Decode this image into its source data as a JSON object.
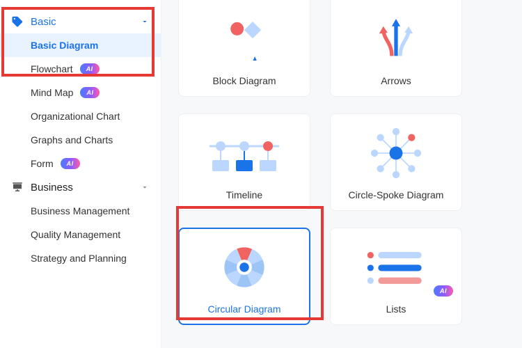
{
  "sidebar": {
    "groups": [
      {
        "id": "basic",
        "label": "Basic",
        "expanded": true,
        "items": [
          {
            "label": "Basic Diagram",
            "selected": true
          },
          {
            "label": "Flowchart",
            "ai": true
          },
          {
            "label": "Mind Map",
            "ai": true
          },
          {
            "label": "Organizational Chart"
          },
          {
            "label": "Graphs and Charts"
          },
          {
            "label": "Form",
            "ai": true
          }
        ]
      },
      {
        "id": "business",
        "label": "Business",
        "expanded": true,
        "items": [
          {
            "label": "Business Management"
          },
          {
            "label": "Quality Management"
          },
          {
            "label": "Strategy and Planning"
          }
        ]
      }
    ]
  },
  "ai_badge_text": "AI",
  "gallery": {
    "items": [
      {
        "label": "Block Diagram",
        "icon": "block-diagram-icon",
        "partial_top": true
      },
      {
        "label": "Arrows",
        "icon": "arrows-icon",
        "partial_top": true
      },
      {
        "label": "Timeline",
        "icon": "timeline-icon"
      },
      {
        "label": "Circle-Spoke Diagram",
        "icon": "circle-spoke-icon"
      },
      {
        "label": "Circular Diagram",
        "icon": "circular-diagram-icon",
        "selected": true
      },
      {
        "label": "Lists",
        "icon": "lists-icon",
        "ai": true
      }
    ]
  },
  "colors": {
    "accent": "#1a73e8",
    "accent_light": "#bcd7ff",
    "red": "#f06360",
    "annot": "#e53935"
  }
}
